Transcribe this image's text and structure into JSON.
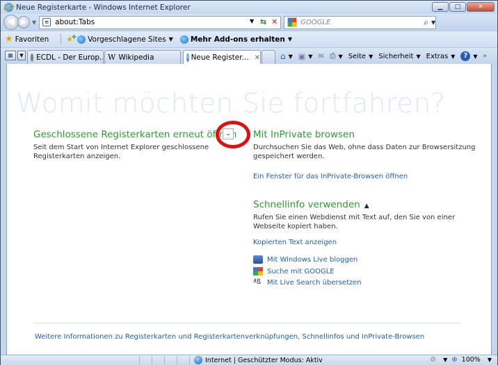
{
  "window": {
    "title": "Neue Registerkarte - Windows Internet Explorer",
    "min_label": "▁",
    "max_label": "□",
    "close_label": "✕"
  },
  "address": {
    "url": "about:Tabs",
    "search_placeholder": "GOOGLE"
  },
  "favorites_bar": {
    "favorites_label": "Favoriten",
    "suggested_sites": "Vorgeschlagene Sites",
    "addons": "Mehr Add-ons erhalten"
  },
  "tabs": [
    {
      "label": "ECDL - Der Europ...",
      "icon": "ecdl-icon"
    },
    {
      "label": "Wikipedia",
      "icon": "wikipedia-icon"
    },
    {
      "label": "Neue Register...",
      "icon": "ie-icon",
      "active": true
    }
  ],
  "command_bar": {
    "page": "Seite",
    "safety": "Sicherheit",
    "tools": "Extras"
  },
  "content": {
    "heading": "Womit möchten Sie fortfahren?",
    "reopen": {
      "title": "Geschlossene Registerkarten erneut öffnen",
      "desc": "Seit dem Start von Internet Explorer geschlossene Registerkarten anzeigen."
    },
    "inprivate": {
      "title": "Mit InPrivate browsen",
      "desc": "Durchsuchen Sie das Web, ohne dass Daten zur Browsersitzung gespeichert werden.",
      "link": "Ein Fenster für das InPrivate-Browsen öffnen"
    },
    "accelerators": {
      "title": "Schnellinfo verwenden",
      "desc": "Rufen Sie einen Webdienst mit Text auf, den Sie von einer Webseite kopiert haben.",
      "link": "Kopierten Text anzeigen",
      "items": [
        {
          "label": "Mit Windows Live bloggen",
          "icon": "blog-icon"
        },
        {
          "label": "Suche mit GOOGLE",
          "icon": "google-icon"
        },
        {
          "label": "Mit Live Search übersetzen",
          "icon": "translate-icon"
        }
      ]
    },
    "footer_link": "Weitere Informationen zu Registerkarten und Registerkartenverknüpfungen, Schnellinfos und InPrivate-Browsen"
  },
  "status": {
    "zone": "Internet | Geschützter Modus: Aktiv",
    "zoom": "100%"
  },
  "colors": {
    "section_title": "#2e9c2e",
    "link": "#1c5fb8",
    "highlight_circle": "#e01010"
  }
}
